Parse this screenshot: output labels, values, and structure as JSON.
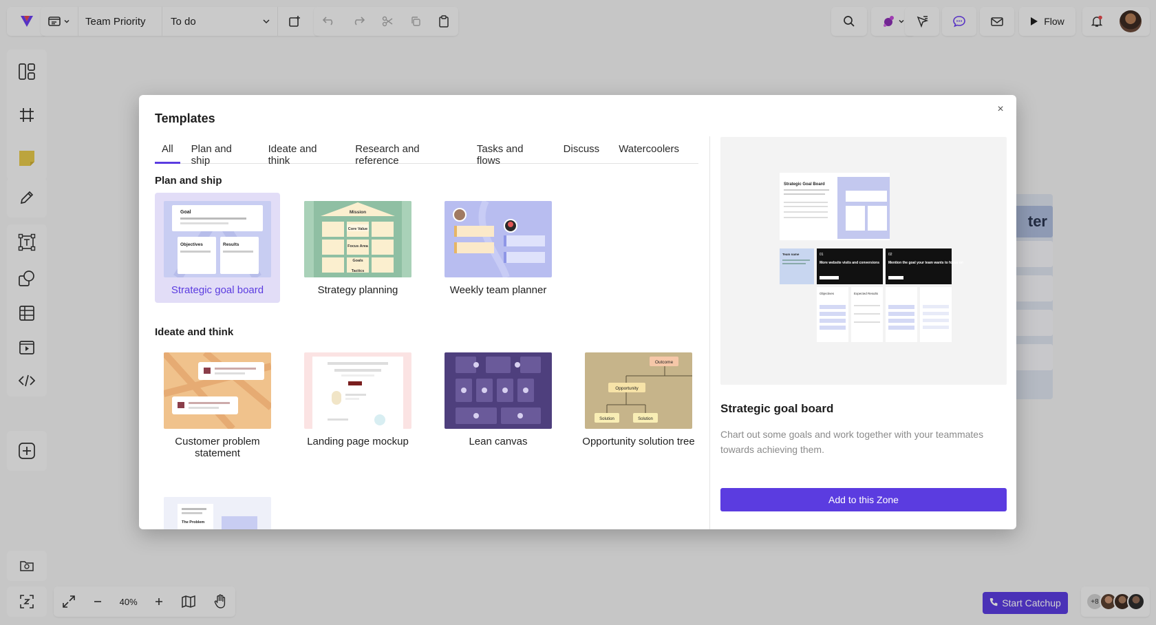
{
  "topbar": {
    "board_name": "Team Priority",
    "zone_select": "To do",
    "flow_label": "Flow"
  },
  "zoom": {
    "level": "40%"
  },
  "background_zone": {
    "title_fragment": "ter"
  },
  "modal": {
    "title": "Templates",
    "close_glyph": "×",
    "tabs": [
      "All",
      "Plan and ship",
      "Ideate and think",
      "Research and reference",
      "Tasks and flows",
      "Discuss",
      "Watercoolers"
    ],
    "sections": {
      "plan": {
        "heading": "Plan and ship",
        "cards": [
          "Strategic goal board",
          "Strategy planning",
          "Weekly team planner"
        ]
      },
      "ideate": {
        "heading": "Ideate and think",
        "cards": [
          "Customer problem statement",
          "Landing page mockup",
          "Lean canvas",
          "Opportunity solution tree"
        ]
      }
    },
    "thumb_text": {
      "goal": "Goal",
      "objectives": "Objectives",
      "results": "Results",
      "mission": "Mission",
      "core_value": "Core Value",
      "focus_area": "Focus Area",
      "goals": "Goals",
      "tactics": "Tactics",
      "outcome": "Outcome",
      "opportunity": "Opportunity",
      "solution1": "Solution",
      "solution2": "Solution",
      "problem": "The Problem"
    },
    "preview": {
      "title": "Strategic goal board",
      "description": "Chart out some goals and work together with your teammates towards achieving them.",
      "button": "Add to this Zone",
      "mini": {
        "heading": "Strategic Goal Board",
        "team_name": "Team name",
        "card1": "More website visits and conversions",
        "card2": "Mention the goal your team wants to focus on",
        "num1": "01",
        "num2": "02",
        "col_objectives": "Objectives",
        "col_results": "Expected Results"
      }
    }
  },
  "footer": {
    "catchup_label": "Start Catchup",
    "avatar_count": "+8"
  },
  "colors": {
    "accent": "#5b3ce0",
    "selected_bg": "#e2ddf7"
  }
}
